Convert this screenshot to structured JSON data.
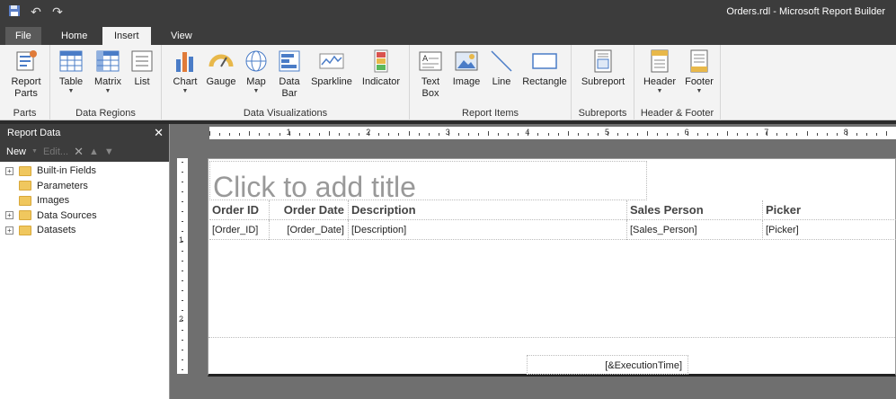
{
  "window": {
    "title": "Orders.rdl - Microsoft Report Builder"
  },
  "qat": {
    "save_icon": "save-icon",
    "undo_icon": "undo-icon",
    "redo_icon": "redo-icon"
  },
  "tabs": [
    {
      "label": "File"
    },
    {
      "label": "Home"
    },
    {
      "label": "Insert"
    },
    {
      "label": "View"
    }
  ],
  "ribbon": {
    "groups": {
      "parts": {
        "label": "Parts",
        "buttons": [
          {
            "label1": "Report",
            "label2": "Parts"
          }
        ]
      },
      "data_regions": {
        "label": "Data Regions",
        "buttons": [
          {
            "label": "Table"
          },
          {
            "label": "Matrix"
          },
          {
            "label": "List"
          }
        ]
      },
      "data_viz": {
        "label": "Data Visualizations",
        "buttons": [
          {
            "label": "Chart"
          },
          {
            "label": "Gauge"
          },
          {
            "label": "Map"
          },
          {
            "label1": "Data",
            "label2": "Bar"
          },
          {
            "label": "Sparkline"
          },
          {
            "label": "Indicator"
          }
        ]
      },
      "report_items": {
        "label": "Report Items",
        "buttons": [
          {
            "label1": "Text",
            "label2": "Box"
          },
          {
            "label": "Image"
          },
          {
            "label": "Line"
          },
          {
            "label": "Rectangle"
          }
        ]
      },
      "subreports": {
        "label": "Subreports",
        "buttons": [
          {
            "label": "Subreport"
          }
        ]
      },
      "header_footer": {
        "label": "Header & Footer",
        "buttons": [
          {
            "label": "Header"
          },
          {
            "label": "Footer"
          }
        ]
      }
    }
  },
  "panel": {
    "title": "Report Data",
    "close": "✕",
    "toolbar": {
      "new": "New",
      "edit": "Edit..."
    },
    "tree": [
      {
        "label": "Built-in Fields",
        "expandable": true
      },
      {
        "label": "Parameters",
        "expandable": false
      },
      {
        "label": "Images",
        "expandable": false
      },
      {
        "label": "Data Sources",
        "expandable": true
      },
      {
        "label": "Datasets",
        "expandable": true
      }
    ]
  },
  "ruler": {
    "top_numbers": [
      "1",
      "2",
      "3",
      "4",
      "5",
      "6",
      "7",
      "8"
    ],
    "left_numbers": [
      "1",
      "2"
    ]
  },
  "report": {
    "title_placeholder": "Click to add title",
    "headers": [
      "Order ID",
      "Order Date",
      "Description",
      "Sales Person",
      "Picker"
    ],
    "cells": [
      "[Order_ID]",
      "[Order_Date]",
      "[Description]",
      "[Sales_Person]",
      "[Picker]"
    ],
    "footer_expression": "[&ExecutionTime]"
  }
}
